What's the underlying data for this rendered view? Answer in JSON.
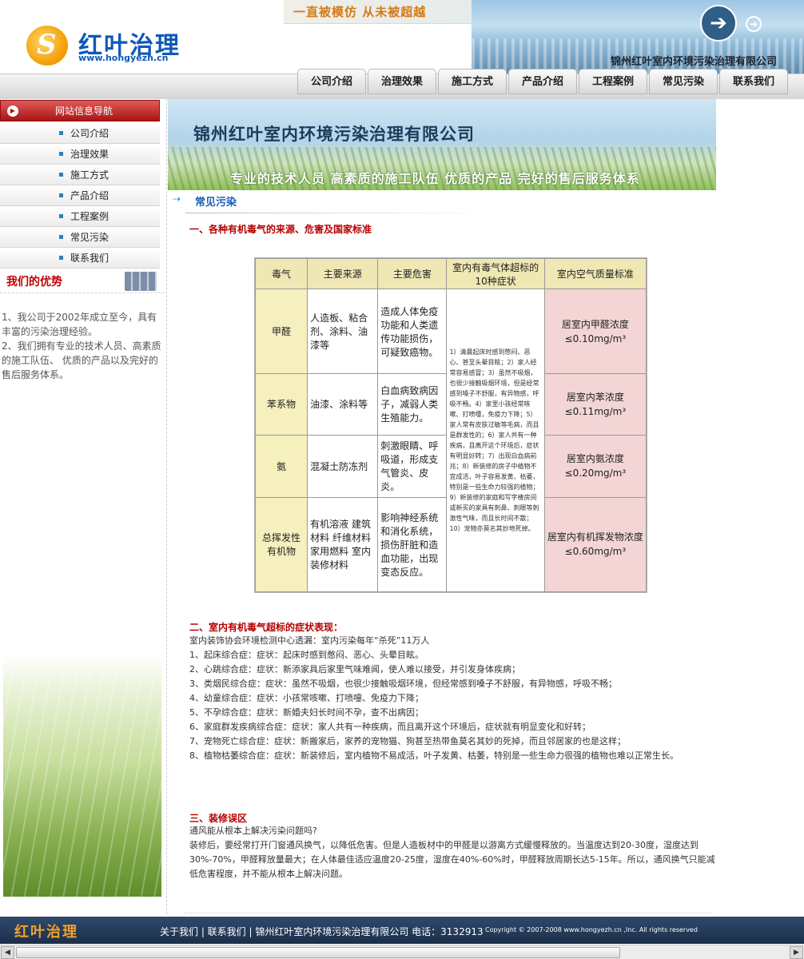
{
  "header": {
    "slogan": "一直被模仿  从未被超越",
    "company": "锦州红叶室内环境污染治理有限公司",
    "logo_name": "红叶治理",
    "logo_url": "www.hongyezh.cn"
  },
  "nav": [
    "公司介绍",
    "治理效果",
    "施工方式",
    "产品介绍",
    "工程案例",
    "常见污染",
    "联系我们"
  ],
  "sidebar": {
    "title": "网站信息导航",
    "items": [
      "公司介绍",
      "治理效果",
      "施工方式",
      "产品介绍",
      "工程案例",
      "常见污染",
      "联系我们"
    ],
    "adv_title": "我们的优势",
    "adv_text_1": "1、我公司于2002年成立至今，具有丰富的污染治理经验。",
    "adv_text_2": "2、我们拥有专业的技术人员、高素质的施工队伍、 优质的产品以及完好的售后服务体系。"
  },
  "banner": {
    "title": "锦州红叶室内环境污染治理有限公司",
    "subtitle": "专业的技术人员   高素质的施工队伍   优质的产品   完好的售后服务体系"
  },
  "section": {
    "title": "常见污染"
  },
  "part1": {
    "heading": "一、各种有机毒气的来源、危害及国家标准",
    "table": {
      "headers": [
        "毒气",
        "主要来源",
        "主要危害",
        "室内有毒气体超标的10种症状",
        "室内空气质量标准"
      ],
      "rows": [
        {
          "name": "甲醛",
          "source": "人造板、粘合剂、涂料、油漆等",
          "harm": "造成人体免疫功能和人类遗传功能损伤，可疑致癌物。",
          "std": "居室内甲醛浓度≤0.10mg/m³"
        },
        {
          "name": "苯系物",
          "source": "油漆、涂料等",
          "harm": "白血病致病因子，减弱人类生殖能力。",
          "std": "居室内苯浓度≤0.11mg/m³"
        },
        {
          "name": "氨",
          "source": "混凝土防冻剂",
          "harm": "刺激眼睛、呼吸道，形成支气管炎、皮炎。",
          "std": "居室内氨浓度≤0.20mg/m³"
        },
        {
          "name": "总挥发性有机物",
          "source": "有机溶液 建筑材料 纤维材料 家用燃料 室内装修材料",
          "harm": "影响神经系统和消化系统，损伤肝脏和造血功能，出现变态反应。",
          "std": "居室内有机挥发物浓度≤0.60mg/m³"
        }
      ],
      "symptoms": "1）清晨起床时感到憋闷、恶心、甚至头晕目眩；2）家人经常容易感冒；3）虽然不吸烟，也很少接触吸烟环境，但是经常感到嗓子不舒服，有异物感，呼吸不畅。4）家里小孩经常咳嗽、打喷嚏，免疫力下降；5）家人常有皮肤过敏等毛病，而且是群发性的；6）家人共有一种疾病，且离开这个环境后，症状有明显好转；7）出现白血病前兆；8）新装修的房子中植物不宜成活，叶子容易发黄、枯萎，特别是一些生命力较强的植物；9）新装修的家庭和写字楼房间或新买的家具有刺鼻、刺眼等刺激性气味，而且长时间不散；10）宠物亦莫名其妙地死掉。"
    }
  },
  "part2": {
    "heading": "二、室内有机毒气超标的症状表现：",
    "lines": [
      "室内装饰协会环境检测中心透漏：室内污染每年“杀死”11万人",
      "1、起床综合症：症状：起床时感到憋闷、恶心、头晕目眩。",
      "2、心跳综合症：症状：新添家具后家里气味难闻，使人难以接受，并引发身体疾病；",
      "3、类烟民综合症：症状：虽然不吸烟，也很少接触吸烟环境，但经常感到嗓子不舒服，有异物感，呼吸不畅；",
      "4、幼童综合症：症状：小孩常咳嗽、打喷嚏、免疫力下降；",
      "5、不孕综合症：症状：新婚夫妇长时间不孕，查不出病因；",
      "6、家庭群发疾病综合症：症状：家人共有一种疾病，而且离开这个环境后，症状就有明显变化和好转；",
      "7、宠物死亡综合症：症状：新搬家后，家养的宠物猫、狗甚至热带鱼莫名其妙的死掉，而且邻居家的也是这样；",
      "8、植物枯萎综合症：症状：新装修后，室内植物不易成活，叶子发黄、枯萎，特别是一些生命力很强的植物也难以正常生长。"
    ]
  },
  "part3": {
    "heading": "三、装修误区",
    "lines": [
      "通风能从根本上解决污染问题吗?",
      "装修后，要经常打开门窗通风换气，以降低危害。但是人造板材中的甲醛是以游离方式缓慢释放的。当温度达到20-30度，湿度达到30%-70%，甲醛释放量最大；在人体最佳适应温度20-25度，湿度在40%-60%时，甲醛释放周期长达5-15年。所以，通风换气只能减低危害程度，并不能从根本上解决问题。"
    ]
  },
  "footer": {
    "logo": "红叶治理",
    "links": "关于我们 | 联系我们 | 锦州红叶室内环境污染治理有限公司 电话：3132913",
    "copyright": "Copyright © 2007-2008 www.hongyezh.cn ,Inc. All rights reserved"
  }
}
